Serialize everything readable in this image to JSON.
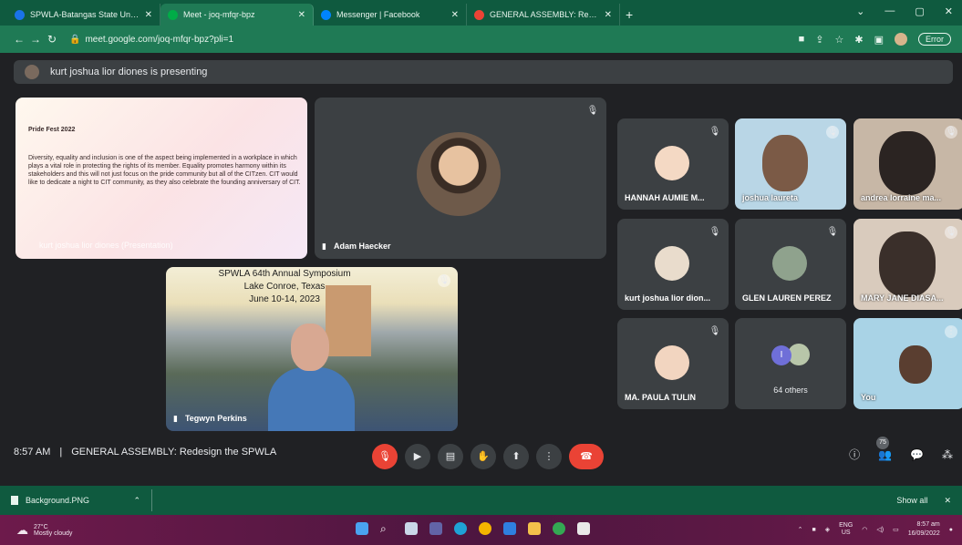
{
  "browser": {
    "tabs": [
      {
        "title": "SPWLA-Batangas State Universit",
        "color": "#1a73e8"
      },
      {
        "title": "Meet - joq-mfqr-bpz",
        "color": "#00ac47"
      },
      {
        "title": "Messenger | Facebook",
        "color": "#0084ff"
      },
      {
        "title": "GENERAL ASSEMBLY: Redesign t",
        "color": "#ea4335"
      }
    ],
    "url": "meet.google.com/joq-mfqr-bpz?pli=1",
    "error_label": "Error"
  },
  "banner": {
    "text": "kurt joshua lior diones is presenting"
  },
  "tiles": {
    "slide": {
      "heading": "Pride Fest 2022",
      "body": "Diversity, equality and inclusion is one of the aspect being implemented in a workplace in which plays a vital role in protecting the rights of its member. Equality promotes harmony within its stakeholders and this will not just focus on the pride community but all of the CITzen. CIT would like to dedicate a night to CIT community, as they also celebrate the founding anniversary of CIT.",
      "owner": "kurt joshua lior diones (Presentation)"
    },
    "adam": {
      "name": "Adam Haecker"
    },
    "tegwyn": {
      "name": "Tegwyn Perkins",
      "line1": "SPWLA 64th Annual Symposium",
      "line2": "Lake Conroe, Texas",
      "line3": "June 10-14, 2023"
    },
    "grid": [
      {
        "name": "HANNAH AUMIE M...",
        "type": "avatar",
        "color": "#f4d9c4"
      },
      {
        "name": "joshua laureta",
        "type": "cam",
        "color": "#b9d6e6"
      },
      {
        "name": "andrea lorraine ma...",
        "type": "cam",
        "color": "#c7b7a6"
      },
      {
        "name": "kurt joshua lior dion...",
        "type": "avatar",
        "color": "#e9dccc"
      },
      {
        "name": "GLEN LAUREN PEREZ",
        "type": "avatar",
        "color": "#8fa28d"
      },
      {
        "name": "MARY JANE DIASA...",
        "type": "cam",
        "color": "#d9cbbd"
      },
      {
        "name": "MA. PAULA TULIN",
        "type": "avatar",
        "color": "#f2d5c0"
      },
      {
        "name": "64 others",
        "type": "others",
        "color": "#3c4043"
      },
      {
        "name": "You",
        "type": "cam",
        "color": "#a9d3e6"
      }
    ]
  },
  "meeting": {
    "time": "8:57 AM",
    "title": "GENERAL ASSEMBLY: Redesign the SPWLA",
    "participant_count": "75"
  },
  "download": {
    "file": "Background.PNG",
    "show_all": "Show all"
  },
  "taskbar": {
    "temp": "27°C",
    "weather": "Mostly cloudy",
    "lang1": "ENG",
    "lang2": "US",
    "time": "8:57 am",
    "date": "16/09/2022"
  }
}
